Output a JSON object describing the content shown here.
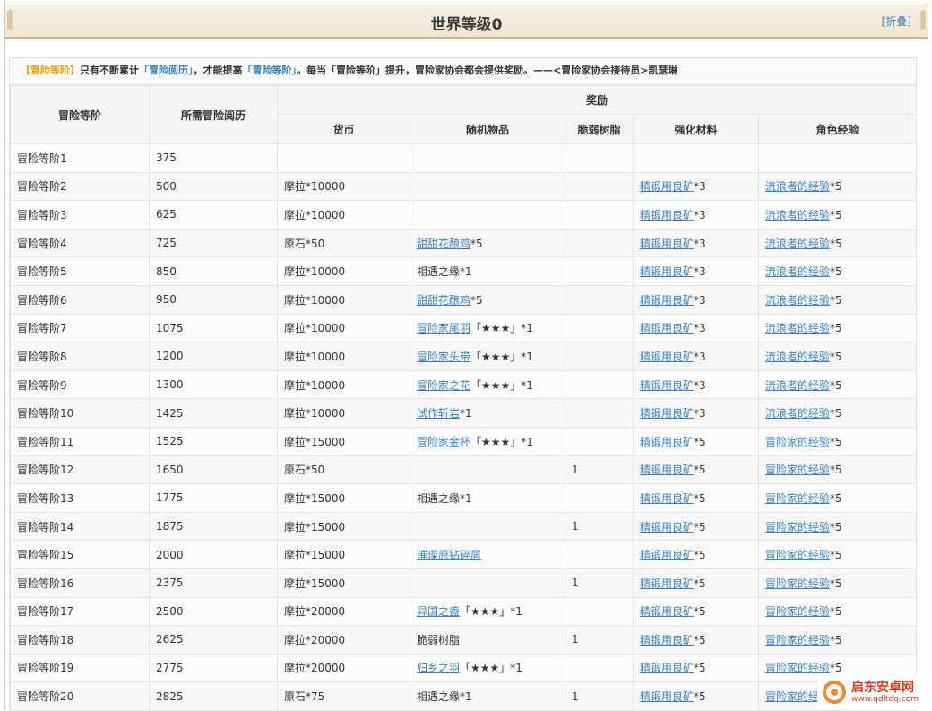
{
  "header": {
    "title": "世界等级0",
    "fold_label": "[折叠]"
  },
  "intro": {
    "part1": "【冒险等阶】",
    "part2": "只有不断累计",
    "part3": "「冒险阅历」",
    "part4": "，才能提高",
    "part5": "「冒险等阶」",
    "part6": "。每当「冒险等阶」提升，冒险家协会都会提供奖励。——<冒险家协会接待员>凯瑟琳"
  },
  "table": {
    "headers": {
      "rank": "冒险等阶",
      "exp": "所需冒险阅历",
      "reward": "奖励",
      "currency": "货币",
      "random_item": "随机物品",
      "resin": "脆弱树脂",
      "material": "强化材料",
      "char_exp": "角色经验"
    },
    "rows": [
      {
        "rank": "冒险等阶1",
        "exp": "375",
        "currency": "",
        "item_link": "",
        "item_suffix": "",
        "resin": "",
        "material_link": "",
        "material_suffix": "",
        "charexp_link": "",
        "charexp_suffix": ""
      },
      {
        "rank": "冒险等阶2",
        "exp": "500",
        "currency": "摩拉*10000",
        "item_link": "",
        "item_suffix": "",
        "resin": "",
        "material_link": "精锻用良矿",
        "material_suffix": "*3",
        "charexp_link": "流浪者的经验",
        "charexp_suffix": "*5"
      },
      {
        "rank": "冒险等阶3",
        "exp": "625",
        "currency": "摩拉*10000",
        "item_link": "",
        "item_suffix": "",
        "resin": "",
        "material_link": "精锻用良矿",
        "material_suffix": "*3",
        "charexp_link": "流浪者的经验",
        "charexp_suffix": "*5"
      },
      {
        "rank": "冒险等阶4",
        "exp": "725",
        "currency": "原石*50",
        "item_link": "甜甜花酿鸡",
        "item_suffix": "*5",
        "resin": "",
        "material_link": "精锻用良矿",
        "material_suffix": "*3",
        "charexp_link": "流浪者的经验",
        "charexp_suffix": "*5"
      },
      {
        "rank": "冒险等阶5",
        "exp": "850",
        "currency": "摩拉*10000",
        "item_link": "",
        "item_suffix": "相遇之缘*1",
        "resin": "",
        "material_link": "精锻用良矿",
        "material_suffix": "*3",
        "charexp_link": "流浪者的经验",
        "charexp_suffix": "*5"
      },
      {
        "rank": "冒险等阶6",
        "exp": "950",
        "currency": "摩拉*10000",
        "item_link": "甜甜花酿鸡",
        "item_suffix": "*5",
        "resin": "",
        "material_link": "精锻用良矿",
        "material_suffix": "*3",
        "charexp_link": "流浪者的经验",
        "charexp_suffix": "*5"
      },
      {
        "rank": "冒险等阶7",
        "exp": "1075",
        "currency": "摩拉*10000",
        "item_link": "冒险家尾羽",
        "item_suffix": "「★★★」*1",
        "resin": "",
        "material_link": "精锻用良矿",
        "material_suffix": "*3",
        "charexp_link": "流浪者的经验",
        "charexp_suffix": "*5"
      },
      {
        "rank": "冒险等阶8",
        "exp": "1200",
        "currency": "摩拉*10000",
        "item_link": "冒险家头带",
        "item_suffix": "「★★★」*1",
        "resin": "",
        "material_link": "精锻用良矿",
        "material_suffix": "*3",
        "charexp_link": "流浪者的经验",
        "charexp_suffix": "*5"
      },
      {
        "rank": "冒险等阶9",
        "exp": "1300",
        "currency": "摩拉*10000",
        "item_link": "冒险家之花",
        "item_suffix": "「★★★」*1",
        "resin": "",
        "material_link": "精锻用良矿",
        "material_suffix": "*3",
        "charexp_link": "流浪者的经验",
        "charexp_suffix": "*5"
      },
      {
        "rank": "冒险等阶10",
        "exp": "1425",
        "currency": "摩拉*10000",
        "item_link": "试作斩岩",
        "item_suffix": "*1",
        "resin": "",
        "material_link": "精锻用良矿",
        "material_suffix": "*3",
        "charexp_link": "流浪者的经验",
        "charexp_suffix": "*5"
      },
      {
        "rank": "冒险等阶11",
        "exp": "1525",
        "currency": "摩拉*15000",
        "item_link": "冒险家金杯",
        "item_suffix": "「★★★」*1",
        "resin": "",
        "material_link": "精锻用良矿",
        "material_suffix": "*5",
        "charexp_link": "冒险家的经验",
        "charexp_suffix": "*5"
      },
      {
        "rank": "冒险等阶12",
        "exp": "1650",
        "currency": "原石*50",
        "item_link": "",
        "item_suffix": "",
        "resin": "1",
        "material_link": "精锻用良矿",
        "material_suffix": "*5",
        "charexp_link": "冒险家的经验",
        "charexp_suffix": "*5"
      },
      {
        "rank": "冒险等阶13",
        "exp": "1775",
        "currency": "摩拉*15000",
        "item_link": "",
        "item_suffix": "相遇之缘*1",
        "resin": "",
        "material_link": "精锻用良矿",
        "material_suffix": "*5",
        "charexp_link": "冒险家的经验",
        "charexp_suffix": "*5"
      },
      {
        "rank": "冒险等阶14",
        "exp": "1875",
        "currency": "摩拉*15000",
        "item_link": "",
        "item_suffix": "",
        "resin": "1",
        "material_link": "精锻用良矿",
        "material_suffix": "*5",
        "charexp_link": "冒险家的经验",
        "charexp_suffix": "*5"
      },
      {
        "rank": "冒险等阶15",
        "exp": "2000",
        "currency": "摩拉*15000",
        "item_link": "璀璨原钻碎屑",
        "item_suffix": "",
        "resin": "",
        "material_link": "精锻用良矿",
        "material_suffix": "*5",
        "charexp_link": "冒险家的经验",
        "charexp_suffix": "*5"
      },
      {
        "rank": "冒险等阶16",
        "exp": "2375",
        "currency": "摩拉*15000",
        "item_link": "",
        "item_suffix": "",
        "resin": "1",
        "material_link": "精锻用良矿",
        "material_suffix": "*5",
        "charexp_link": "冒险家的经验",
        "charexp_suffix": "*5"
      },
      {
        "rank": "冒险等阶17",
        "exp": "2500",
        "currency": "摩拉*20000",
        "item_link": "异国之盏",
        "item_suffix": "「★★★」*1",
        "resin": "",
        "material_link": "精锻用良矿",
        "material_suffix": "*5",
        "charexp_link": "冒险家的经验",
        "charexp_suffix": "*5"
      },
      {
        "rank": "冒险等阶18",
        "exp": "2625",
        "currency": "摩拉*20000",
        "item_link": "",
        "item_suffix": "脆弱树脂",
        "resin": "1",
        "material_link": "精锻用良矿",
        "material_suffix": "*5",
        "charexp_link": "冒险家的经验",
        "charexp_suffix": "*5"
      },
      {
        "rank": "冒险等阶19",
        "exp": "2775",
        "currency": "摩拉*20000",
        "item_link": "归乡之羽",
        "item_suffix": "「★★★」*1",
        "resin": "",
        "material_link": "精锻用良矿",
        "material_suffix": "*5",
        "charexp_link": "冒险家的经验",
        "charexp_suffix": "*5"
      },
      {
        "rank": "冒险等阶20",
        "exp": "2825",
        "currency": "原石*75",
        "item_link": "",
        "item_suffix": "相遇之缘*1",
        "resin": "1",
        "material_link": "精锻用良矿",
        "material_suffix": "*5",
        "charexp_link": "冒险家的经",
        "charexp_suffix": ""
      }
    ]
  },
  "watermark": {
    "name": "启东安卓网",
    "url": "www.qdltdq.com"
  },
  "colors": {
    "link": "#3b80c4",
    "gold": "#e8a317",
    "watermark": "#d9361c"
  }
}
